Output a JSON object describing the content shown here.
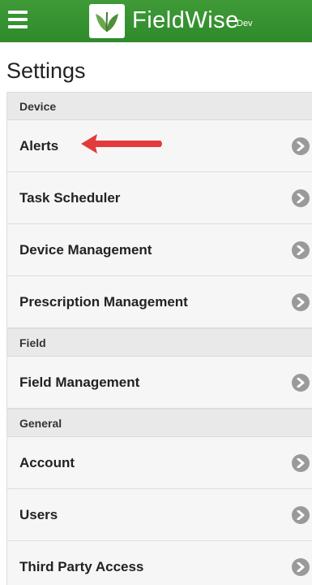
{
  "header": {
    "brand": "FieldWise",
    "env": "Dev",
    "menu_icon": "hamburger-menu-icon",
    "logo_icon": "leaf-logo-icon",
    "color": "#3a9534"
  },
  "page": {
    "title": "Settings"
  },
  "sections": {
    "device": {
      "label": "Device",
      "items": [
        "Alerts",
        "Task Scheduler",
        "Device Management",
        "Prescription Management"
      ]
    },
    "field": {
      "label": "Field",
      "items": [
        "Field Management"
      ]
    },
    "general": {
      "label": "General",
      "items": [
        "Account",
        "Users",
        "Third Party Access"
      ]
    }
  },
  "annotation": {
    "arrow_icon": "red-pointer-arrow",
    "color": "#e23b3b"
  },
  "chevron_icon": "chevron-right-circle-icon"
}
